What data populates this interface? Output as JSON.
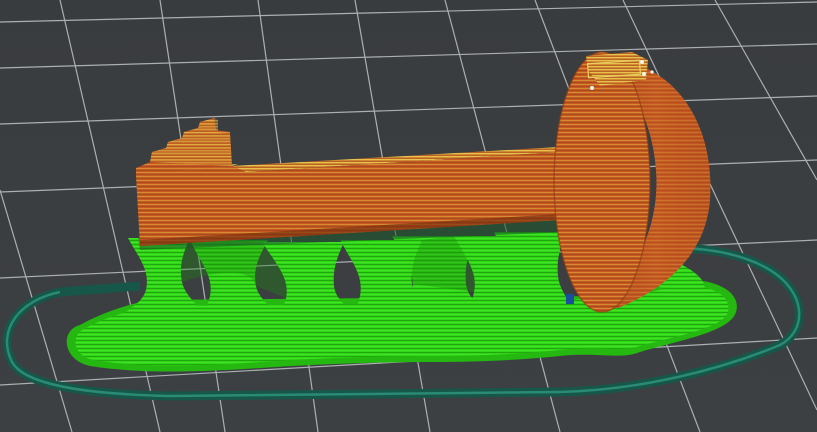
{
  "scene": {
    "background_color": "#3a3d40",
    "grid_line_color": "#b9bcbf",
    "skirt_color": "#1f6b59",
    "support_color": "#2fd615",
    "support_shadow_color": "#1a8a0c",
    "model_color": "#c65a24",
    "model_highlight_color": "#d9b23a",
    "model_shadow_color": "#8a3a14",
    "infill_accent_color": "#1a4fa0"
  }
}
